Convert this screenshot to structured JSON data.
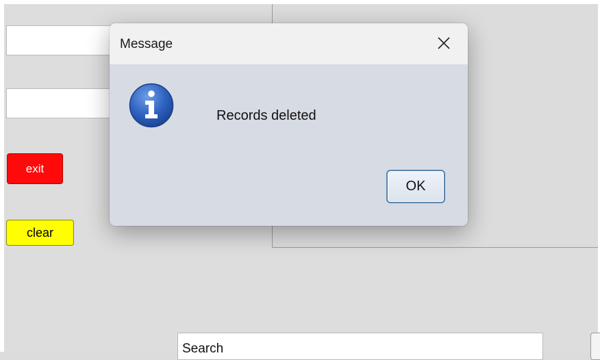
{
  "background_form": {
    "field1_value": "",
    "field2_value": "",
    "exit_label": "exit",
    "clear_label": "clear",
    "search_value": "Search"
  },
  "dialog": {
    "title": "Message",
    "message": "Records deleted",
    "ok_label": "OK",
    "icon": "info-icon",
    "close_icon": "close-icon"
  },
  "colors": {
    "exit_button": "#ff0a0a",
    "clear_button": "#ffff00",
    "ok_border": "#5a84ad",
    "info_icon": "#2f63c1"
  }
}
